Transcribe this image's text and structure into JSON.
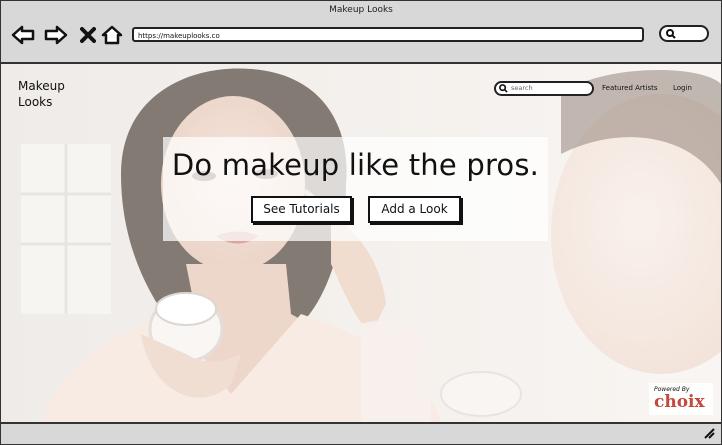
{
  "window": {
    "title": "Makeup Looks"
  },
  "browser": {
    "url": "https://makeuplooks.co",
    "back_icon": "back-arrow-icon",
    "forward_icon": "forward-arrow-icon",
    "close_icon": "close-x-icon",
    "home_icon": "home-icon",
    "search_icon": "search-icon"
  },
  "site": {
    "brand_line1": "Makeup",
    "brand_line2": "Looks",
    "search_placeholder": "search",
    "nav": [
      "Featured Artists",
      "Login"
    ]
  },
  "hero": {
    "title": "Do makeup like the pros.",
    "buttons": [
      "See Tutorials",
      "Add a Look"
    ]
  },
  "footer_badge": {
    "label": "Powered By",
    "brand": "choix",
    "brand_color": "#c4493f"
  }
}
